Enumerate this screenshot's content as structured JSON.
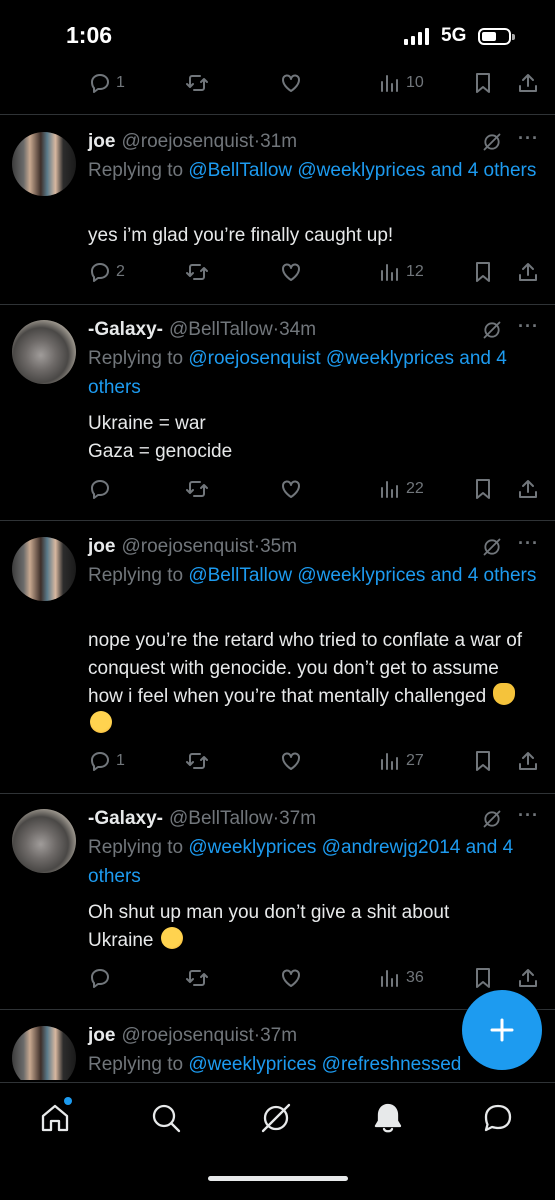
{
  "status_bar": {
    "time": "1:06",
    "network": "5G"
  },
  "top_actions": {
    "replies": "1",
    "views": "10"
  },
  "tweets": [
    {
      "name": "joe",
      "handle": "@roejosenquist",
      "time": "31m",
      "reply_prefix": "Replying to",
      "reply_links": "@BellTallow @weeklyprices and 4 others",
      "body": "yes i’m glad you’re finally caught up!",
      "replies": "2",
      "views": "12"
    },
    {
      "name": "-Galaxy-",
      "handle": "@BellTallow",
      "time": "34m",
      "reply_prefix": "Replying to",
      "reply_links": "@roejosenquist @weeklyprices and 4 others",
      "body_lines": [
        "Ukraine = war",
        "Gaza = genocide"
      ],
      "replies": "",
      "views": "22"
    },
    {
      "name": "joe",
      "handle": "@roejosenquist",
      "time": "35m",
      "reply_prefix": "Replying to",
      "reply_links": "@BellTallow @weeklyprices and 4 others",
      "body": "nope you’re the retard who tried to conflate a war of conquest with genocide. you don’t get to assume how i feel when you’re that mentally challenged",
      "emojis": [
        "victory-hand-emoji",
        "loudly-crying-face-emoji"
      ],
      "replies": "1",
      "views": "27"
    },
    {
      "name": "-Galaxy-",
      "handle": "@BellTallow",
      "time": "37m",
      "reply_prefix": "Replying to",
      "reply_links": "@weeklyprices @andrewjg2014 and 4 others",
      "body": "Oh shut up man you don’t give a shit about Ukraine",
      "emojis": [
        "rolling-on-floor-laughing-emoji"
      ],
      "replies": "",
      "views": "36"
    },
    {
      "name": "joe",
      "handle": "@roejosenquist",
      "time": "37m",
      "reply_prefix": "Replying to",
      "reply_links": "@weeklyprices @refreshnessed"
    }
  ],
  "separator": "·",
  "more_label": "···",
  "nav": [
    "home-icon",
    "search-icon",
    "grok-icon",
    "notifications-icon",
    "messages-icon"
  ],
  "colors": {
    "accent": "#1d9bf0",
    "muted": "#71767b",
    "text": "#e7e9ea",
    "background": "#000000",
    "divider": "#2f3336"
  }
}
